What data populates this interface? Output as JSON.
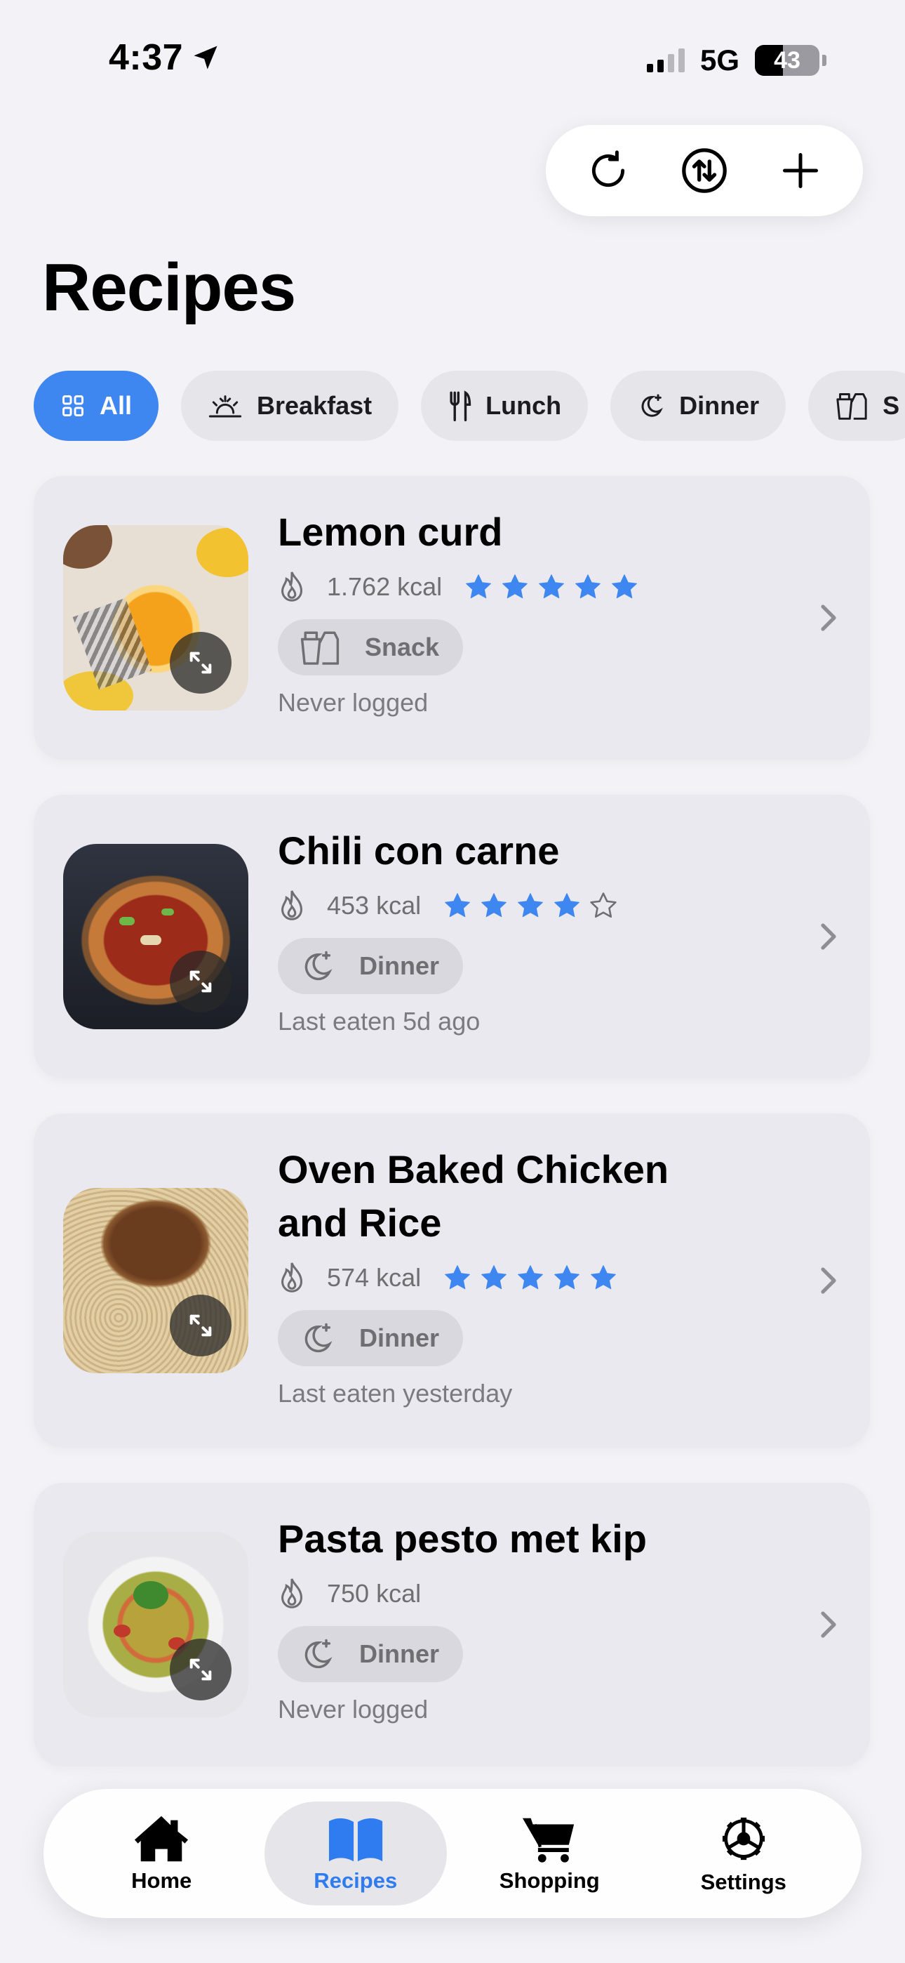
{
  "status": {
    "time": "4:37",
    "network": "5G",
    "battery": "43"
  },
  "toolbar": {
    "refresh_icon": "refresh-icon",
    "sort_icon": "sort-icon",
    "add_icon": "plus-icon"
  },
  "page": {
    "title": "Recipes"
  },
  "categories": [
    {
      "label": "All",
      "icon": "grid-icon",
      "active": true
    },
    {
      "label": "Breakfast",
      "icon": "sunrise-icon",
      "active": false
    },
    {
      "label": "Lunch",
      "icon": "fork-knife-icon",
      "active": false
    },
    {
      "label": "Dinner",
      "icon": "moon-stars-icon",
      "active": false
    },
    {
      "label": "S",
      "icon": "snack-icon",
      "active": false
    }
  ],
  "recipes": [
    {
      "title": "Lemon curd",
      "kcal": "1.762 kcal",
      "rating": 5,
      "category": "Snack",
      "last": "Never logged"
    },
    {
      "title": "Chili con carne",
      "kcal": "453 kcal",
      "rating": 4,
      "category": "Dinner",
      "last": "Last eaten 5d ago"
    },
    {
      "title": "Oven Baked Chicken and Rice",
      "kcal": "574 kcal",
      "rating": 5,
      "category": "Dinner",
      "last": "Last eaten yesterday"
    },
    {
      "title": "Pasta pesto met kip",
      "kcal": "750 kcal",
      "rating": 0,
      "category": "Dinner",
      "last": "Never logged"
    }
  ],
  "tabs": [
    {
      "label": "Home",
      "icon": "house-icon",
      "active": false
    },
    {
      "label": "Recipes",
      "icon": "book-icon",
      "active": true
    },
    {
      "label": "Shopping",
      "icon": "cart-icon",
      "active": false
    },
    {
      "label": "Settings",
      "icon": "gear-icon",
      "active": false
    }
  ],
  "colors": {
    "accent": "#3e86f0",
    "card": "#e9e9ef",
    "background": "#f2f2f7",
    "star": "#3e86f0"
  }
}
